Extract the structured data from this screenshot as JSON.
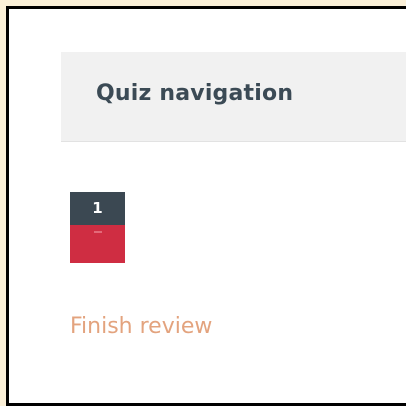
{
  "block": {
    "title": "Quiz navigation"
  },
  "questions": [
    {
      "number": "1",
      "state": "incorrect",
      "state_color": "#cf2d42"
    }
  ],
  "finish_review": {
    "label": "Finish review"
  },
  "colors": {
    "header_background": "#f1f1f1",
    "title_text": "#3b4a55",
    "question_number_background": "#3b4852",
    "link": "#e3a37e",
    "outer_background": "#fbf0d8"
  }
}
